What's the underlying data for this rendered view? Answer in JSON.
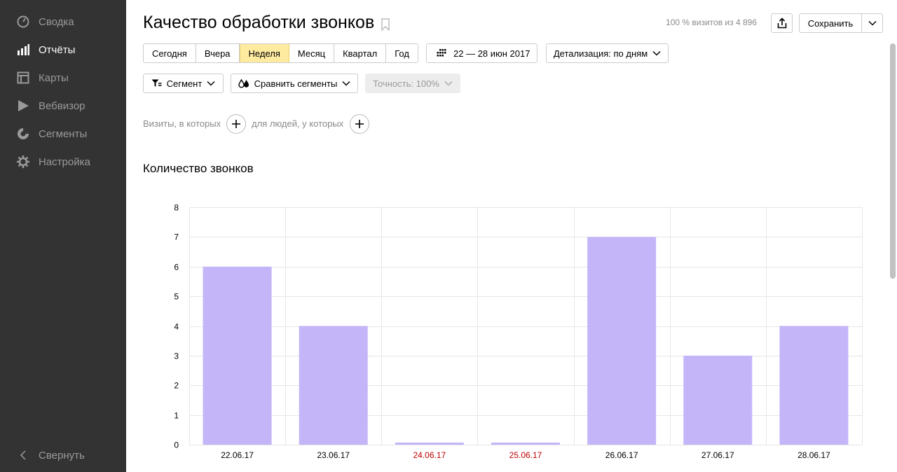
{
  "sidebar": {
    "items": [
      {
        "label": "Сводка",
        "icon": "gauge-icon",
        "active": false
      },
      {
        "label": "Отчёты",
        "icon": "bar-chart-icon",
        "active": true
      },
      {
        "label": "Карты",
        "icon": "map-layout-icon",
        "active": false
      },
      {
        "label": "Вебвизор",
        "icon": "play-icon",
        "active": false
      },
      {
        "label": "Сегменты",
        "icon": "pie-icon",
        "active": false
      },
      {
        "label": "Настройка",
        "icon": "gear-icon",
        "active": false
      }
    ],
    "collapse_label": "Свернуть"
  },
  "header": {
    "title": "Качество обработки звонков",
    "visits_info": "100 % визитов из 4 896",
    "save_label": "Сохранить"
  },
  "toolbar": {
    "periods": [
      "Сегодня",
      "Вчера",
      "Неделя",
      "Месяц",
      "Квартал",
      "Год"
    ],
    "active_period": "Неделя",
    "date_range": "22 — 28 июн 2017",
    "detail": "Детализация: по дням",
    "segment": "Сегмент",
    "compare": "Сравнить сегменты",
    "accuracy": "Точность: 100%"
  },
  "filters": {
    "visits_label": "Визиты, в которых",
    "people_label": "для людей, у которых"
  },
  "colors": {
    "sidebar_bg": "#333333",
    "bar": "#c4b5f8",
    "weekend_label": "#c00000",
    "active_period": "#ffeba0"
  },
  "chart_data": {
    "type": "bar",
    "title": "Количество звонков",
    "categories": [
      "22.06.17",
      "23.06.17",
      "24.06.17",
      "25.06.17",
      "26.06.17",
      "27.06.17",
      "28.06.17"
    ],
    "values": [
      6,
      4,
      0,
      0,
      7,
      3,
      4
    ],
    "weekend": [
      false,
      false,
      true,
      true,
      false,
      false,
      false
    ],
    "ylim": [
      0,
      8
    ],
    "yticks": [
      0,
      1,
      2,
      3,
      4,
      5,
      6,
      7,
      8
    ],
    "grid": true,
    "legend": "none"
  }
}
